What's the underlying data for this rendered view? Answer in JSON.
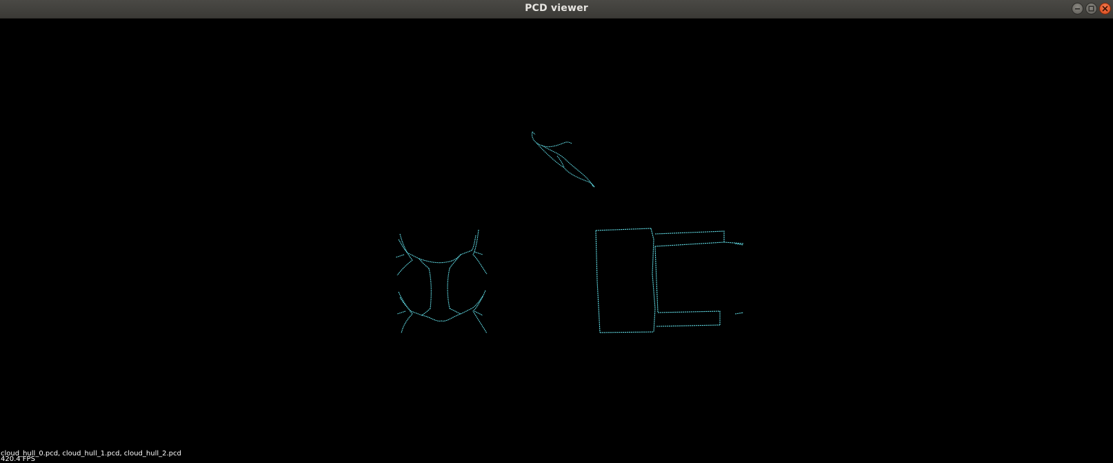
{
  "window": {
    "title": "PCD viewer",
    "controls": [
      {
        "name": "minimize",
        "icon": "minimize-icon"
      },
      {
        "name": "maximize",
        "icon": "maximize-icon"
      },
      {
        "name": "close",
        "icon": "close-icon"
      }
    ]
  },
  "viewer": {
    "background_color": "#000000",
    "hull_color": "#5fd7e0",
    "clouds": [
      {
        "name": "cloud_hull_0.pcd",
        "shape": "wedge-outline"
      },
      {
        "name": "cloud_hull_1.pcd",
        "shape": "quadcopter-outline"
      },
      {
        "name": "cloud_hull_2.pcd",
        "shape": "chair-outline"
      }
    ],
    "loaded_files_text": "cloud_hull_0.pcd, cloud_hull_1.pcd, cloud_hull_2.pcd",
    "fps_text": "420.4 FPS"
  }
}
